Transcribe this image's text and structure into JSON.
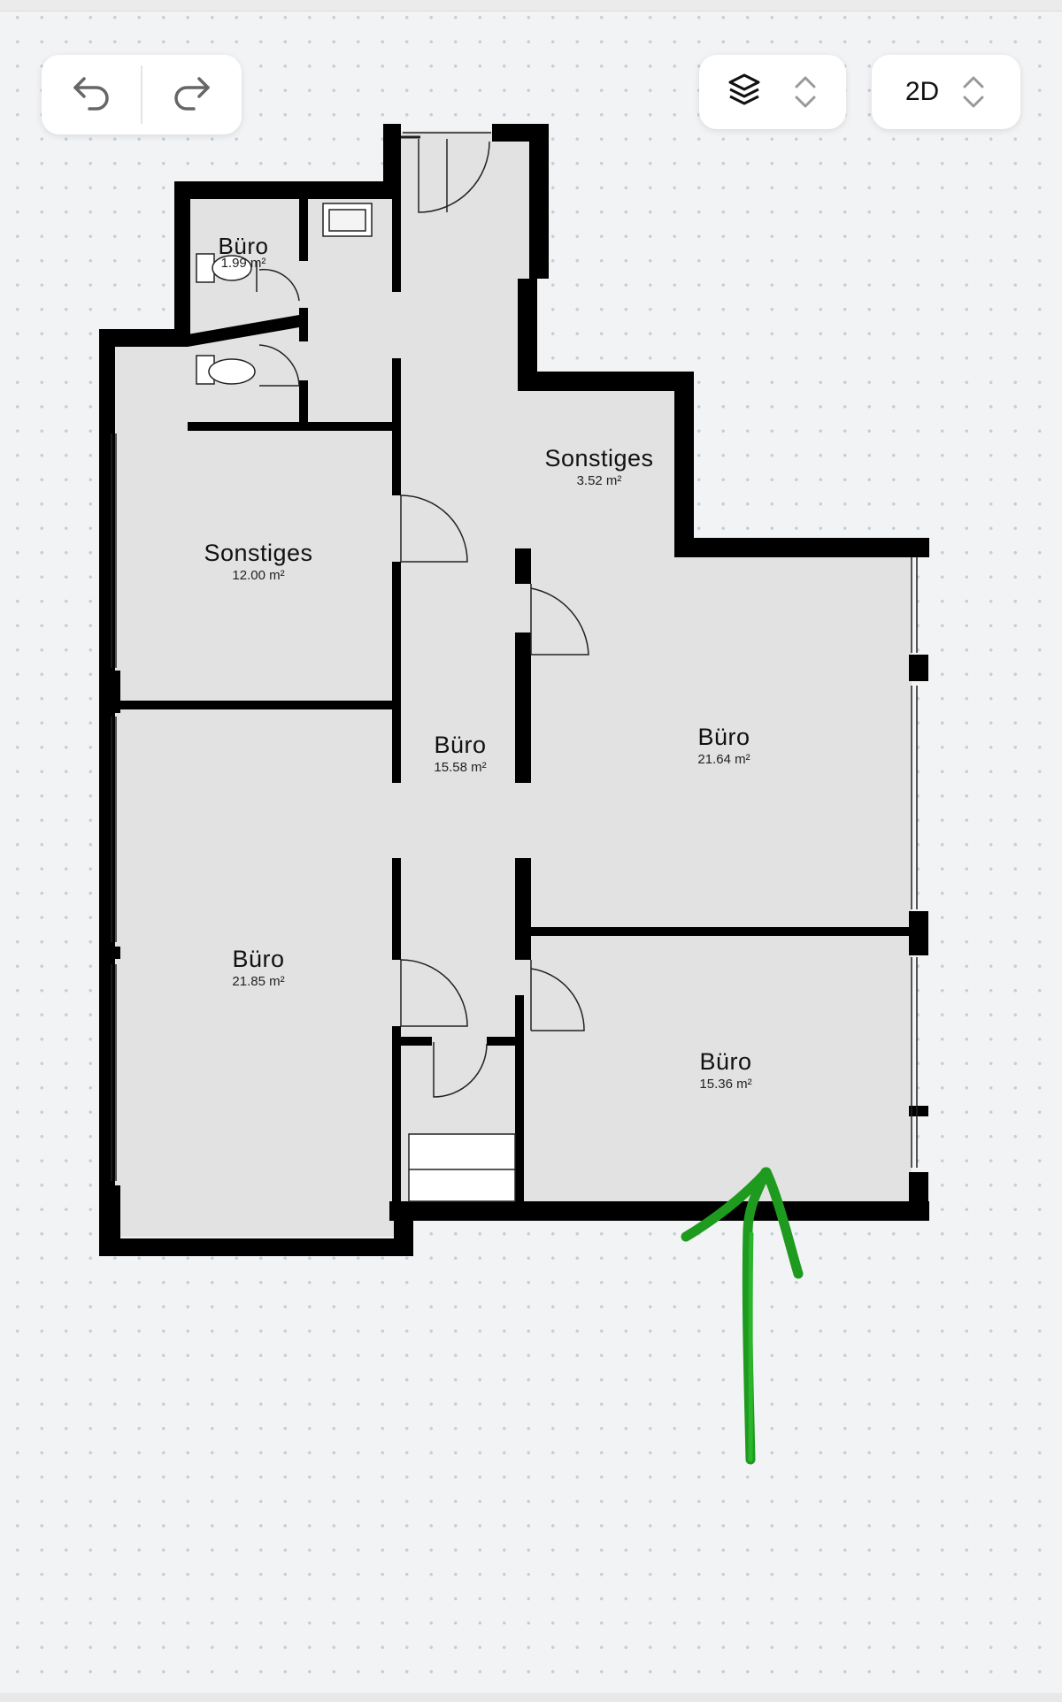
{
  "toolbar": {
    "undo_icon": "undo-arrow-icon",
    "redo_icon": "redo-arrow-icon",
    "layers_icon": "layers-stack-icon",
    "view_mode_label": "2D",
    "chevron_icon": "chevron-up-down-icon"
  },
  "floorplan": {
    "rooms": [
      {
        "name": "Büro",
        "area": "1.99 m²"
      },
      {
        "name": "Sonstiges",
        "area": "3.52 m²"
      },
      {
        "name": "Sonstiges",
        "area": "12.00 m²"
      },
      {
        "name": "Büro",
        "area": "15.58 m²"
      },
      {
        "name": "Büro",
        "area": "21.64 m²"
      },
      {
        "name": "Büro",
        "area": "21.85 m²"
      },
      {
        "name": "Büro",
        "area": "15.36 m²"
      }
    ]
  },
  "annotation": {
    "icon": "hand-drawn-arrow-icon",
    "color": "#1e9a1e"
  },
  "colors": {
    "room_fill": "#e2e2e2",
    "wall": "#000000",
    "background": "#f2f3f5"
  }
}
